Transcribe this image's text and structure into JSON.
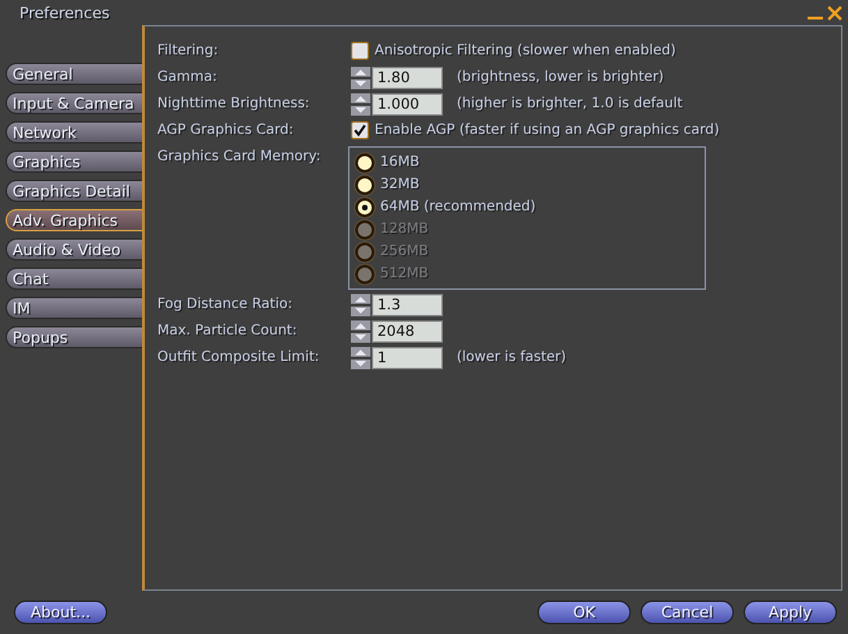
{
  "window": {
    "title": "Preferences"
  },
  "tabs": [
    {
      "label": "General",
      "selected": false
    },
    {
      "label": "Input & Camera",
      "selected": false
    },
    {
      "label": "Network",
      "selected": false
    },
    {
      "label": "Graphics",
      "selected": false
    },
    {
      "label": "Graphics Detail",
      "selected": false
    },
    {
      "label": "Adv. Graphics",
      "selected": true
    },
    {
      "label": "Audio & Video",
      "selected": false
    },
    {
      "label": "Chat",
      "selected": false
    },
    {
      "label": "IM",
      "selected": false
    },
    {
      "label": "Popups",
      "selected": false
    }
  ],
  "rows": [
    {
      "kind": "checkbox",
      "label": "Filtering:",
      "text": "Anisotropic Filtering (slower when enabled)",
      "checked": false
    },
    {
      "kind": "spinner",
      "label": "Gamma:",
      "value": "1.80",
      "hint": "(brightness, lower is brighter)"
    },
    {
      "kind": "spinner",
      "label": "Nighttime Brightness:",
      "value": "1.000",
      "hint": "(higher is brighter, 1.0 is default"
    },
    {
      "kind": "checkbox",
      "label": "AGP Graphics Card:",
      "text": "Enable AGP (faster if using an AGP graphics card)",
      "checked": true
    },
    {
      "kind": "radio",
      "label": "Graphics Card Memory:",
      "options": [
        {
          "text": "16MB",
          "selected": false,
          "disabled": false
        },
        {
          "text": "32MB",
          "selected": false,
          "disabled": false
        },
        {
          "text": "64MB (recommended)",
          "selected": true,
          "disabled": false
        },
        {
          "text": "128MB",
          "selected": false,
          "disabled": true
        },
        {
          "text": "256MB",
          "selected": false,
          "disabled": true
        },
        {
          "text": "512MB",
          "selected": false,
          "disabled": true
        }
      ]
    },
    {
      "kind": "spinner",
      "label": "Fog Distance Ratio:",
      "value": "1.3"
    },
    {
      "kind": "spinner",
      "label": "Max. Particle Count:",
      "value": "2048"
    },
    {
      "kind": "spinner",
      "label": "Outfit Composite Limit:",
      "value": "1",
      "hint": "(lower is faster)"
    }
  ],
  "buttons": {
    "left": [
      "About..."
    ],
    "right": [
      "OK",
      "Cancel",
      "Apply"
    ]
  }
}
